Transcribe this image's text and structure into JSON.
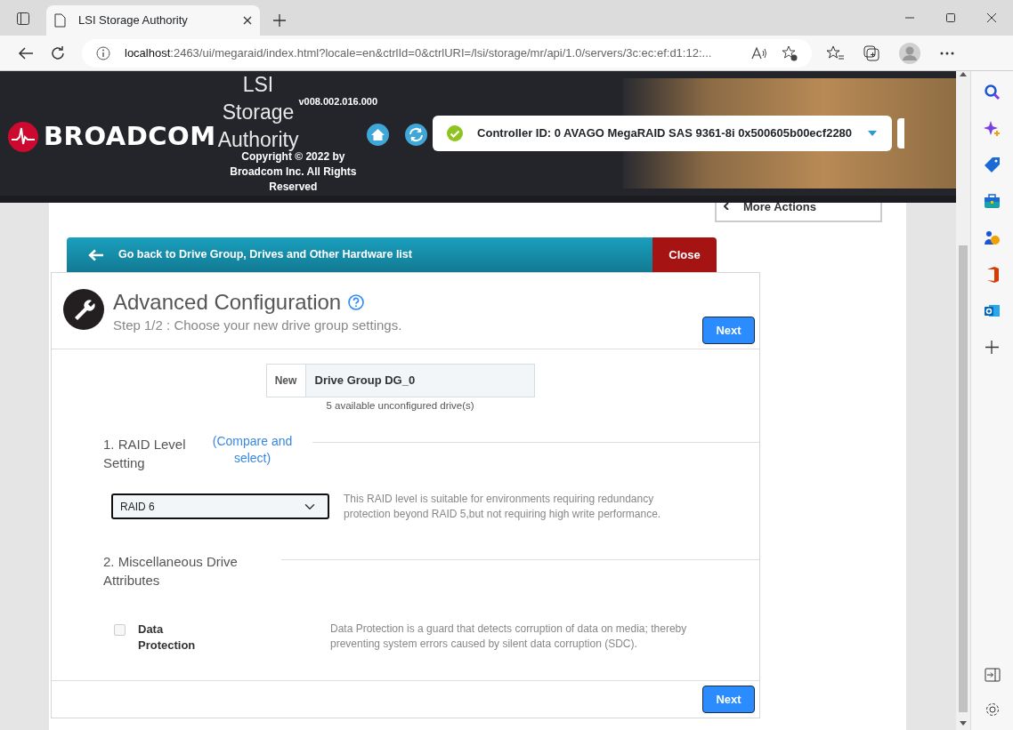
{
  "browser": {
    "tab_title": "LSI Storage Authority",
    "url_host": "localhost",
    "url_path": ":2463/ui/megaraid/index.html?locale=en&ctrlId=0&ctrlURI=/lsi/storage/mr/api/1.0/servers/3c:ec:ef:d1:12:..."
  },
  "header": {
    "logo_text": "BROADCOM",
    "app_name": [
      "LSI",
      "Storage",
      "Authority"
    ],
    "version": "v008.002.016.000",
    "copyright": "Copyright © 2022 by Broadcom Inc. All Rights Reserved",
    "controller": {
      "healthy": true,
      "label": "Controller ID: 0 AVAGO MegaRAID SAS 9361-8i 0x500605b00ecf2280"
    }
  },
  "more_actions": "More Actions",
  "back_bar": {
    "label": "Go back to Drive Group, Drives and Other Hardware list",
    "close": "Close"
  },
  "wizard": {
    "title": "Advanced Configuration",
    "step": "Step 1/2 : Choose your new drive group settings.",
    "next": "Next",
    "drive_group": {
      "prefix": "New",
      "value": "Drive Group DG_0",
      "note": "5 available unconfigured drive(s)"
    },
    "sections": [
      {
        "kind": "select",
        "title": "1. RAID Level Setting",
        "link": "(Compare and select)",
        "value": "RAID 6",
        "description": "This RAID level is suitable for environments requiring redundancy protection beyond RAID 5,but not requiring high write performance."
      },
      {
        "kind": "checkbox",
        "title": "2. Miscellaneous Drive Attributes",
        "label": "Data Protection",
        "checked": false,
        "description": "Data Protection is a guard that detects corruption of data on media; thereby preventing system errors caused by silent data corruption (SDC)."
      }
    ],
    "footer_next": "Next"
  }
}
